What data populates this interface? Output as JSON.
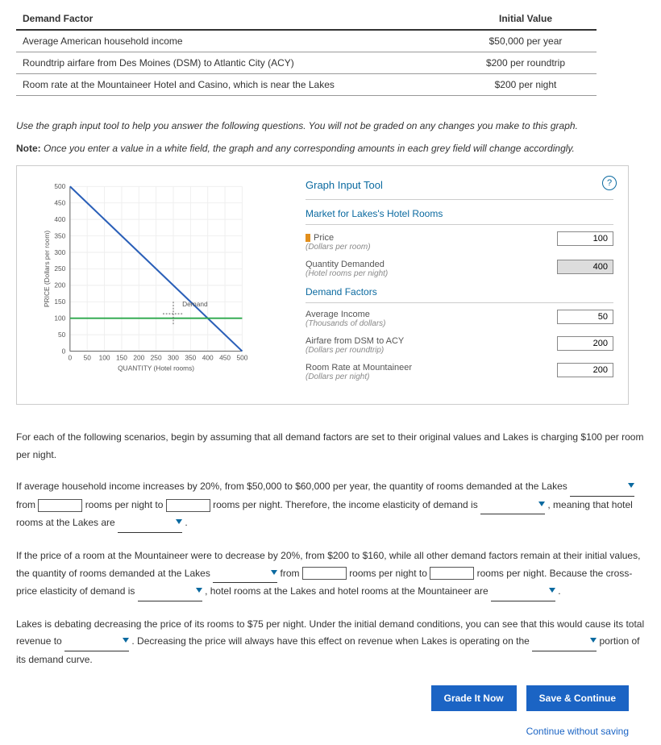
{
  "table": {
    "headers": {
      "factor": "Demand Factor",
      "value": "Initial Value"
    },
    "rows": [
      {
        "factor": "Average American household income",
        "value": "$50,000 per year"
      },
      {
        "factor": "Roundtrip airfare from Des Moines (DSM) to Atlantic City (ACY)",
        "value": "$200 per roundtrip"
      },
      {
        "factor": "Room rate at the Mountaineer Hotel and Casino, which is near the Lakes",
        "value": "$200 per night"
      }
    ]
  },
  "instructions": {
    "line1": "Use the graph input tool to help you answer the following questions. You will not be graded on any changes you make to this graph.",
    "note_label": "Note:",
    "note_text": " Once you enter a value in a white field, the graph and any corresponding amounts in each grey field will change accordingly."
  },
  "graph_tool": {
    "title": "Graph Input Tool",
    "market_section": "Market for Lakes's Hotel Rooms",
    "price_label": "Price",
    "price_sub": "(Dollars per room)",
    "price_value": "100",
    "qty_label": "Quantity Demanded",
    "qty_sub": "(Hotel rooms per night)",
    "qty_value": "400",
    "demand_section": "Demand Factors",
    "income_label": "Average Income",
    "income_sub": "(Thousands of dollars)",
    "income_value": "50",
    "airfare_label": "Airfare from DSM to ACY",
    "airfare_sub": "(Dollars per roundtrip)",
    "airfare_value": "200",
    "roomrate_label": "Room Rate at Mountaineer",
    "roomrate_sub": "(Dollars per night)",
    "roomrate_value": "200",
    "help": "?"
  },
  "chart_data": {
    "type": "line",
    "title": "",
    "xlabel": "QUANTITY (Hotel rooms)",
    "ylabel": "PRICE (Dollars per room)",
    "xlim": [
      0,
      500
    ],
    "ylim": [
      0,
      500
    ],
    "xticks": [
      0,
      50,
      100,
      150,
      200,
      250,
      300,
      350,
      400,
      450,
      500
    ],
    "yticks": [
      0,
      50,
      100,
      150,
      200,
      250,
      300,
      350,
      400,
      450,
      500
    ],
    "series": [
      {
        "name": "Demand",
        "type": "line",
        "points": [
          [
            0,
            500
          ],
          [
            500,
            0
          ]
        ],
        "color": "#2a5fb8"
      },
      {
        "name": "Price level",
        "type": "hline",
        "y": 100,
        "color": "#2ba84a"
      }
    ],
    "marker": {
      "x": 300,
      "y": 120,
      "label": "Demand"
    }
  },
  "questions": {
    "intro": "For each of the following scenarios, begin by assuming that all demand factors are set to their original values and Lakes is charging $100 per room per night.",
    "q1a": "If average household income increases by 20%, from $50,000 to $60,000 per year, the quantity of rooms demanded at the Lakes ",
    "q1b": " from ",
    "q1c": " rooms per night to ",
    "q1d": " rooms per night. Therefore, the income elasticity of demand is ",
    "q1e": " , meaning that hotel rooms at the Lakes are ",
    "q1f": " .",
    "q2a": "If the price of a room at the Mountaineer were to decrease by 20%, from $200 to $160, while all other demand factors remain at their initial values, the quantity of rooms demanded at the Lakes ",
    "q2b": " from ",
    "q2c": " rooms per night to ",
    "q2d": " rooms per night. Because the cross-price elasticity of demand is ",
    "q2e": " , hotel rooms at the Lakes and hotel rooms at the Mountaineer are ",
    "q2f": " .",
    "q3a": "Lakes is debating decreasing the price of its rooms to $75 per night. Under the initial demand conditions, you can see that this would cause its total revenue to ",
    "q3b": " . Decreasing the price will always have this effect on revenue when Lakes is operating on the ",
    "q3c": " portion of its demand curve."
  },
  "buttons": {
    "grade": "Grade It Now",
    "save": "Save & Continue",
    "continue": "Continue without saving"
  }
}
